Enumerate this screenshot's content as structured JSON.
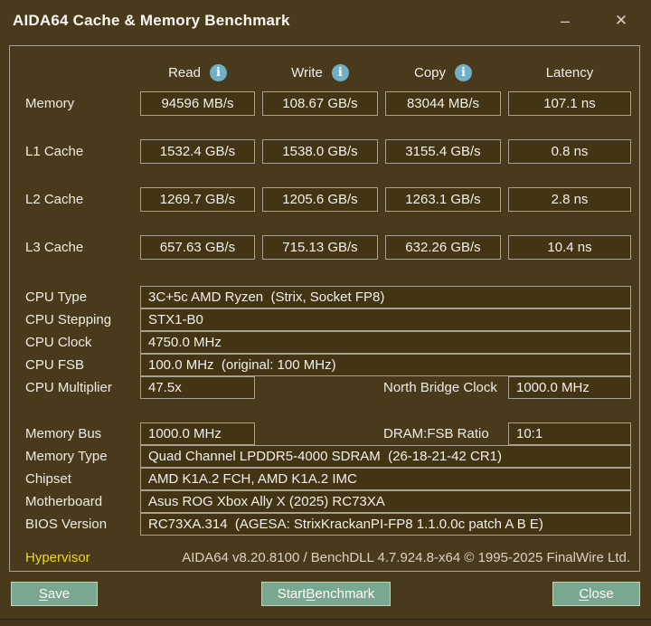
{
  "window": {
    "title": "AIDA64 Cache & Memory Benchmark",
    "minimize_glyph": "–",
    "close_glyph": "✕"
  },
  "icons": {
    "info_glyph": "i"
  },
  "colors": {
    "background": "#4a3a1c",
    "box_fill": "#433413",
    "box_border": "#a8a193",
    "button_green": "#79a78f",
    "info_icon_blue": "#6fb0c7",
    "hypervisor_yellow": "#ecdc07"
  },
  "benchmark": {
    "columns": [
      {
        "label": "Read",
        "info": true
      },
      {
        "label": "Write",
        "info": true
      },
      {
        "label": "Copy",
        "info": true
      },
      {
        "label": "Latency",
        "info": false
      }
    ],
    "rows": [
      {
        "label": "Memory",
        "read": "94596 MB/s",
        "write": "108.67 GB/s",
        "copy": "83044 MB/s",
        "latency": "107.1 ns"
      },
      {
        "label": "L1 Cache",
        "read": "1532.4 GB/s",
        "write": "1538.0 GB/s",
        "copy": "3155.4 GB/s",
        "latency": "0.8 ns"
      },
      {
        "label": "L2 Cache",
        "read": "1269.7 GB/s",
        "write": "1205.6 GB/s",
        "copy": "1263.1 GB/s",
        "latency": "2.8 ns"
      },
      {
        "label": "L3 Cache",
        "read": "657.63 GB/s",
        "write": "715.13 GB/s",
        "copy": "632.26 GB/s",
        "latency": "10.4 ns"
      }
    ]
  },
  "cpu_info": {
    "rows": [
      {
        "label": "CPU Type",
        "value": "3C+5c AMD Ryzen  (Strix, Socket FP8)"
      },
      {
        "label": "CPU Stepping",
        "value": "STX1-B0"
      },
      {
        "label": "CPU Clock",
        "value": "4750.0 MHz"
      },
      {
        "label": "CPU FSB",
        "value": "100.0 MHz  (original: 100 MHz)"
      }
    ],
    "multiplier_row": {
      "label": "CPU Multiplier",
      "value": "47.5x",
      "right_label": "North Bridge Clock",
      "right_value": "1000.0 MHz"
    }
  },
  "memory_info": {
    "bus_row": {
      "label": "Memory Bus",
      "value": "1000.0 MHz",
      "right_label": "DRAM:FSB Ratio",
      "right_value": "10:1"
    },
    "rows": [
      {
        "label": "Memory Type",
        "value": "Quad Channel LPDDR5-4000 SDRAM  (26-18-21-42 CR1)"
      },
      {
        "label": "Chipset",
        "value": "AMD K1A.2 FCH, AMD K1A.2 IMC"
      },
      {
        "label": "Motherboard",
        "value": "Asus ROG Xbox Ally X (2025) RC73XA"
      },
      {
        "label": "BIOS Version",
        "value": "RC73XA.314  (AGESA: StrixKrackanPI-FP8 1.1.0.0c patch A B E)"
      }
    ]
  },
  "footer": {
    "hypervisor_label": "Hypervisor",
    "version_text": "AIDA64 v8.20.8100 / BenchDLL 4.7.924.8-x64 © 1995-2025 FinalWire Ltd."
  },
  "buttons": {
    "save": {
      "label": "Save",
      "underline_index": 0
    },
    "start": {
      "label": "Start Benchmark",
      "underline_index": 6
    },
    "close": {
      "label": "Close",
      "underline_index": 0
    }
  }
}
